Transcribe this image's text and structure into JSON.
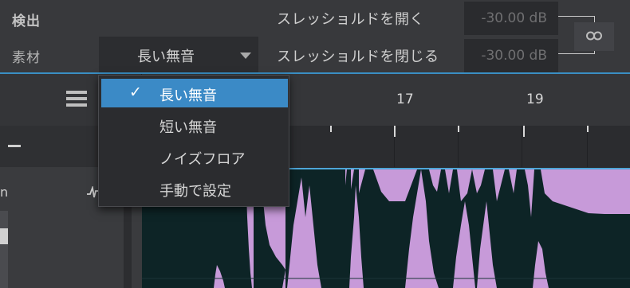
{
  "detection_panel": {
    "title": "検出",
    "material_label": "素材",
    "material_value": "長い無音",
    "threshold_open_label": "スレッショルドを開く",
    "threshold_open_value": "-30.00 dB",
    "threshold_close_label": "スレッショルドを閉じる",
    "threshold_close_value": "-30.00 dB",
    "link_icon": "link-icon"
  },
  "timeline": {
    "ruler_marks": [
      "17",
      "19"
    ]
  },
  "track": {
    "name_fragment": "n",
    "minus_icon": "minus-icon"
  },
  "material_menu": {
    "selected_index": 0,
    "check": "✓",
    "items": [
      {
        "label": "長い無音"
      },
      {
        "label": "短い無音"
      },
      {
        "label": "ノイズフロア"
      },
      {
        "label": "手動で設定"
      }
    ]
  },
  "colors": {
    "accent": "#3b8ac6",
    "waveform_fill": "#c79ad9",
    "waveform_bg": "#0d2426"
  }
}
